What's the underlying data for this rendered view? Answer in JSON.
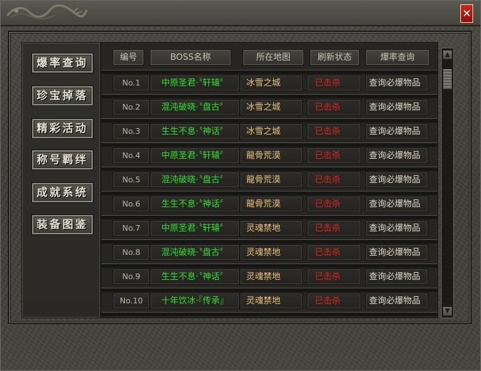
{
  "window": {
    "close_symbol": "✕"
  },
  "sidebar": {
    "items": [
      {
        "label": "爆率查询"
      },
      {
        "label": "珍宝掉落"
      },
      {
        "label": "精彩活动"
      },
      {
        "label": "称号羁绊"
      },
      {
        "label": "成就系统"
      },
      {
        "label": "装备图鉴"
      }
    ]
  },
  "table": {
    "headers": [
      "编号",
      "BOSS名称",
      "所在地图",
      "刷新状态",
      "爆率查询"
    ],
    "rows": [
      {
        "no": "No.1",
        "name": "中原圣君·〝轩辕〞",
        "map": "冰雪之城",
        "status": "已击杀",
        "query": "查询必爆物品"
      },
      {
        "no": "No.2",
        "name": "混沌破晓·〝盘古〞",
        "map": "冰雪之城",
        "status": "已击杀",
        "query": "查询必爆物品"
      },
      {
        "no": "No.3",
        "name": "生生不息·〝神话〞",
        "map": "冰雪之城",
        "status": "已击杀",
        "query": "查询必爆物品"
      },
      {
        "no": "No.4",
        "name": "中原圣君·〝轩辕〞",
        "map": "龍骨荒漠",
        "status": "已击杀",
        "query": "查询必爆物品"
      },
      {
        "no": "No.5",
        "name": "混沌破晓·〝盘古〞",
        "map": "龍骨荒漠",
        "status": "已击杀",
        "query": "查询必爆物品"
      },
      {
        "no": "No.6",
        "name": "生生不息·〝神话〞",
        "map": "龍骨荒漠",
        "status": "已击杀",
        "query": "查询必爆物品"
      },
      {
        "no": "No.7",
        "name": "中原圣君·〝轩辕〞",
        "map": "灵魂禁地",
        "status": "已击杀",
        "query": "查询必爆物品"
      },
      {
        "no": "No.8",
        "name": "混沌破晓·〝盘古〞",
        "map": "灵魂禁地",
        "status": "已击杀",
        "query": "查询必爆物品"
      },
      {
        "no": "No.9",
        "name": "生生不息·〝神话〞",
        "map": "灵魂禁地",
        "status": "已击杀",
        "query": "查询必爆物品"
      },
      {
        "no": "No.10",
        "name": "十年饮冰·『传承』",
        "map": "灵魂禁地",
        "status": "已击杀",
        "query": "查询必爆物品"
      }
    ]
  },
  "scrollbar": {
    "up_symbol": "▲",
    "down_symbol": "▼"
  },
  "colors": {
    "boss_name": "#2fe02f",
    "map": "#e7c37a",
    "status_killed": "#e2241c",
    "close_button": "#c41e16"
  }
}
